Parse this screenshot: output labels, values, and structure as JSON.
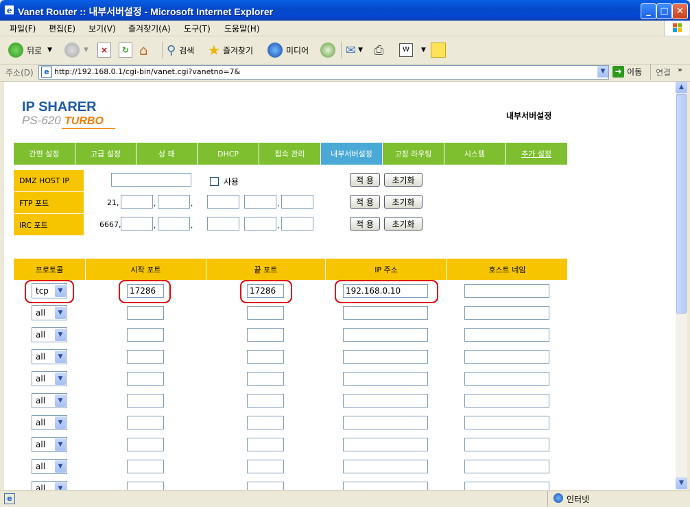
{
  "window": {
    "title": "Vanet Router :: 내부서버설정 - Microsoft Internet Explorer"
  },
  "menu": [
    "파일(F)",
    "편집(E)",
    "보기(V)",
    "즐겨찾기(A)",
    "도구(T)",
    "도움말(H)"
  ],
  "toolbar": {
    "back_label": "뒤로",
    "search_label": "검색",
    "favorites_label": "즐겨찾기",
    "media_label": "미디어"
  },
  "address": {
    "label": "주소(D)",
    "url": "http://192.168.0.1/cgi-bin/vanet.cgi?vanetno=7&",
    "go_label": "이동",
    "links_label": "연결"
  },
  "logo": {
    "line1": "IP SHARER",
    "model": "PS-620",
    "turbo": "TURBO"
  },
  "page": {
    "title": "내부서버설정"
  },
  "tabs": [
    {
      "label": "간편 설정",
      "active": false
    },
    {
      "label": "고급 설정",
      "active": false
    },
    {
      "label": "상 태",
      "active": false
    },
    {
      "label": "DHCP",
      "active": false
    },
    {
      "label": "접속 관리",
      "active": false
    },
    {
      "label": "내부서버설정",
      "active": true
    },
    {
      "label": "고정 라우팅",
      "active": false
    },
    {
      "label": "시스템",
      "active": false
    },
    {
      "label": "추가 설정",
      "active": false,
      "link": true
    }
  ],
  "dmz": {
    "label": "DMZ HOST IP",
    "value": "",
    "use_label": "사용",
    "apply_label": "적 용",
    "reset_label": "초기화"
  },
  "ftp": {
    "label": "FTP 포트",
    "prefix": "21,",
    "apply_label": "적 용",
    "reset_label": "초기화"
  },
  "irc": {
    "label": "IRC 포트",
    "prefix": "6667,",
    "apply_label": "적 용",
    "reset_label": "초기화"
  },
  "table": {
    "headers": [
      "프로토콜",
      "시작 포트",
      "끝 포트",
      "IP 주소",
      "호스트 네임"
    ],
    "rows": [
      {
        "protocol": "tcp",
        "start": "17286",
        "end": "17286",
        "ip": "192.168.0.10",
        "host": ""
      },
      {
        "protocol": "all",
        "start": "",
        "end": "",
        "ip": "",
        "host": ""
      },
      {
        "protocol": "all",
        "start": "",
        "end": "",
        "ip": "",
        "host": ""
      },
      {
        "protocol": "all",
        "start": "",
        "end": "",
        "ip": "",
        "host": ""
      },
      {
        "protocol": "all",
        "start": "",
        "end": "",
        "ip": "",
        "host": ""
      },
      {
        "protocol": "all",
        "start": "",
        "end": "",
        "ip": "",
        "host": ""
      },
      {
        "protocol": "all",
        "start": "",
        "end": "",
        "ip": "",
        "host": ""
      },
      {
        "protocol": "all",
        "start": "",
        "end": "",
        "ip": "",
        "host": ""
      },
      {
        "protocol": "all",
        "start": "",
        "end": "",
        "ip": "",
        "host": ""
      },
      {
        "protocol": "all",
        "start": "",
        "end": "",
        "ip": "",
        "host": ""
      }
    ]
  },
  "status": {
    "zone_label": "인터넷"
  },
  "colors": {
    "nav_green": "#7dbf2e",
    "nav_active_blue": "#4aa9d6",
    "label_yellow": "#f7c500",
    "highlight_red": "#e00000",
    "xp_title_blue": "#0546d2"
  }
}
